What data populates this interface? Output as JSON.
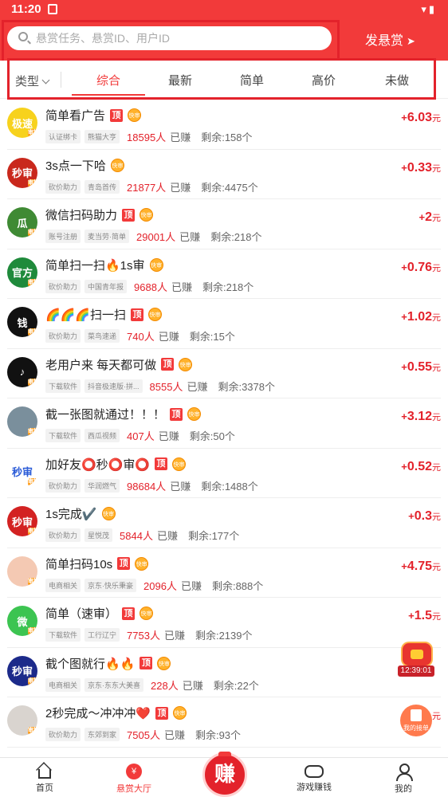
{
  "status_bar": {
    "time": "11:20"
  },
  "header": {
    "search_placeholder": "悬赏任务、悬赏ID、用户ID",
    "publish_label": "发悬赏",
    "publish_icon": "paper-plane-icon"
  },
  "filter": {
    "type_label": "类型",
    "tabs": [
      "综合",
      "最新",
      "简单",
      "高价",
      "未做"
    ],
    "active_tab": "综合"
  },
  "tasks": [
    {
      "avatar_text": "极速",
      "avatar_color": "#f7d21d",
      "title": "简单看广告",
      "top": true,
      "fast": true,
      "tags": [
        "认证绑卡",
        "熊猫大亨"
      ],
      "earned": "18595人",
      "earned_suffix": "已赚",
      "remain": "剩余:158个",
      "price": "6.03",
      "unit": "元"
    },
    {
      "avatar_text": "秒审",
      "avatar_color": "#c9281c",
      "title": "3s点一下哈",
      "top": false,
      "fast": true,
      "tags": [
        "砍价助力",
        "青岛首传"
      ],
      "earned": "21877人",
      "earned_suffix": "已赚",
      "remain": "剩余:4475个",
      "price": "0.33",
      "unit": "元"
    },
    {
      "avatar_text": "瓜",
      "avatar_color": "#3f8a34",
      "title": "微信扫码助力",
      "top": true,
      "fast": true,
      "tags": [
        "账号注册",
        "麦当劳·简单"
      ],
      "earned": "29001人",
      "earned_suffix": "已赚",
      "remain": "剩余:218个",
      "price": "2",
      "unit": "元"
    },
    {
      "avatar_text": "官方",
      "avatar_color": "#1f8a3b",
      "title": "简单扫一扫🔥1s审",
      "top": false,
      "fast": true,
      "tags": [
        "砍价助力",
        "中国青年报"
      ],
      "earned": "9688人",
      "earned_suffix": "已赚",
      "remain": "剩余:218个",
      "price": "0.76",
      "unit": "元"
    },
    {
      "avatar_text": "钱",
      "avatar_color": "#111111",
      "title": "🌈🌈🌈扫一扫",
      "top": true,
      "fast": true,
      "tags": [
        "砍价助力",
        "菜鸟速递"
      ],
      "earned": "740人",
      "earned_suffix": "已赚",
      "remain": "剩余:15个",
      "price": "1.02",
      "unit": "元"
    },
    {
      "avatar_text": "♪",
      "avatar_color": "#111111",
      "title": "老用户来 每天都可做",
      "top": true,
      "fast": true,
      "tags": [
        "下载软件",
        "抖音极速版·拼..."
      ],
      "earned": "8555人",
      "earned_suffix": "已赚",
      "remain": "剩余:3378个",
      "price": "0.55",
      "unit": "元"
    },
    {
      "avatar_text": "",
      "avatar_color": "#7a8f9c",
      "title": "截一张图就通过！！！",
      "top": true,
      "fast": true,
      "tags": [
        "下载软件",
        "西瓜视频"
      ],
      "earned": "407人",
      "earned_suffix": "已赚",
      "remain": "剩余:50个",
      "price": "3.12",
      "unit": "元"
    },
    {
      "avatar_text": "秒审",
      "avatar_color": "#ffffff",
      "title": "加好友⭕秒⭕审⭕",
      "top": true,
      "fast": true,
      "tags": [
        "砍价助力",
        "华润燃气"
      ],
      "earned": "98684人",
      "earned_suffix": "已赚",
      "remain": "剩余:1488个",
      "price": "0.52",
      "unit": "元"
    },
    {
      "avatar_text": "秒审",
      "avatar_color": "#d32222",
      "title": "1s完成✔️",
      "top": false,
      "fast": true,
      "tags": [
        "砍价助力",
        "星悦茂"
      ],
      "earned": "5844人",
      "earned_suffix": "已赚",
      "remain": "剩余:177个",
      "price": "0.3",
      "unit": "元"
    },
    {
      "avatar_text": "",
      "avatar_color": "#f4c9b3",
      "title": "简单扫码10s",
      "top": true,
      "fast": true,
      "tags": [
        "电商相关",
        "京东·快乐秉豪"
      ],
      "earned": "2096人",
      "earned_suffix": "已赚",
      "remain": "剩余:888个",
      "price": "4.75",
      "unit": "元"
    },
    {
      "avatar_text": "微",
      "avatar_color": "#3cc451",
      "title": "简单（速审）",
      "top": true,
      "fast": true,
      "tags": [
        "下载软件",
        "工行辽宁"
      ],
      "earned": "7753人",
      "earned_suffix": "已赚",
      "remain": "剩余:2139个",
      "price": "1.5",
      "unit": "元"
    },
    {
      "avatar_text": "秒审",
      "avatar_color": "#1c2a8a",
      "title": "截个图就行🔥🔥",
      "top": true,
      "fast": true,
      "tags": [
        "电商相关",
        "京东·东东大美喜"
      ],
      "earned": "228人",
      "earned_suffix": "已赚",
      "remain": "剩余:22个",
      "price": "",
      "unit": ""
    },
    {
      "avatar_text": "",
      "avatar_color": "#d9d4cf",
      "title": "2秒完成～冲冲冲❤️",
      "top": true,
      "fast": true,
      "tags": [
        "砍价助力",
        "东郊到家"
      ],
      "earned": "7505人",
      "earned_suffix": "已赚",
      "remain": "剩余:93个",
      "price": "",
      "unit": "元"
    }
  ],
  "badges": {
    "top_label": "顶",
    "fast_label": "快审",
    "avatar_sticker": "审核"
  },
  "floating": {
    "timer": "12:39:01",
    "orders_label": "我的接单"
  },
  "bottom_nav": {
    "items": [
      "首页",
      "悬赏大厅",
      "赚",
      "游戏赚钱",
      "我的"
    ],
    "coin_glyph": "¥"
  },
  "colors": {
    "brand_red": "#f23a3a",
    "price_red": "#e3222b"
  }
}
